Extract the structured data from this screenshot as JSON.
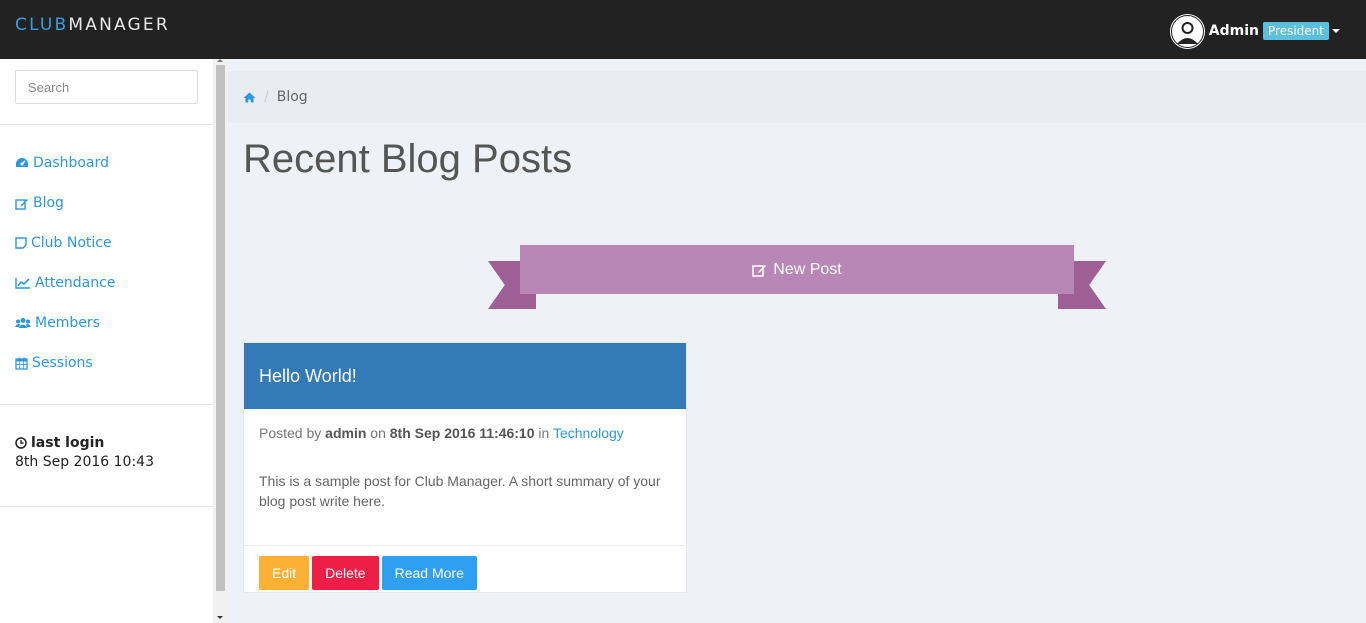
{
  "brand": {
    "part1": "CLUB",
    "part2": "MANAGER"
  },
  "user": {
    "name": "Admin",
    "role": "President"
  },
  "search": {
    "placeholder": "Search"
  },
  "nav": [
    {
      "label": "Dashboard",
      "icon": "dashboard-icon"
    },
    {
      "label": "Blog",
      "icon": "edit-icon"
    },
    {
      "label": "Club Notice",
      "icon": "sticky-note-icon"
    },
    {
      "label": "Attendance",
      "icon": "line-chart-icon"
    },
    {
      "label": "Members",
      "icon": "users-icon"
    },
    {
      "label": "Sessions",
      "icon": "calendar-icon"
    }
  ],
  "last_login": {
    "label": "last login",
    "value": "8th Sep 2016 10:43"
  },
  "breadcrumb": {
    "current": "Blog"
  },
  "page": {
    "title": "Recent Blog Posts",
    "new_post_label": "New Post"
  },
  "post": {
    "title": "Hello World!",
    "posted_by_text": "Posted by",
    "author": "admin",
    "on_text": "on",
    "date": "8th Sep 2016 11:46:10",
    "in_text": "in",
    "category": "Technology",
    "summary": "This is a sample post for Club Manager. A short summary of your blog post write here.",
    "edit_label": "Edit",
    "delete_label": "Delete",
    "read_more_label": "Read More"
  },
  "colors": {
    "topbar": "#222222",
    "accent": "#2a97e0",
    "ribbon": "#b987b5",
    "card_header": "#337ab7",
    "edit": "#fcb034",
    "delete": "#ee1e46",
    "read_more": "#2e9ff1"
  }
}
